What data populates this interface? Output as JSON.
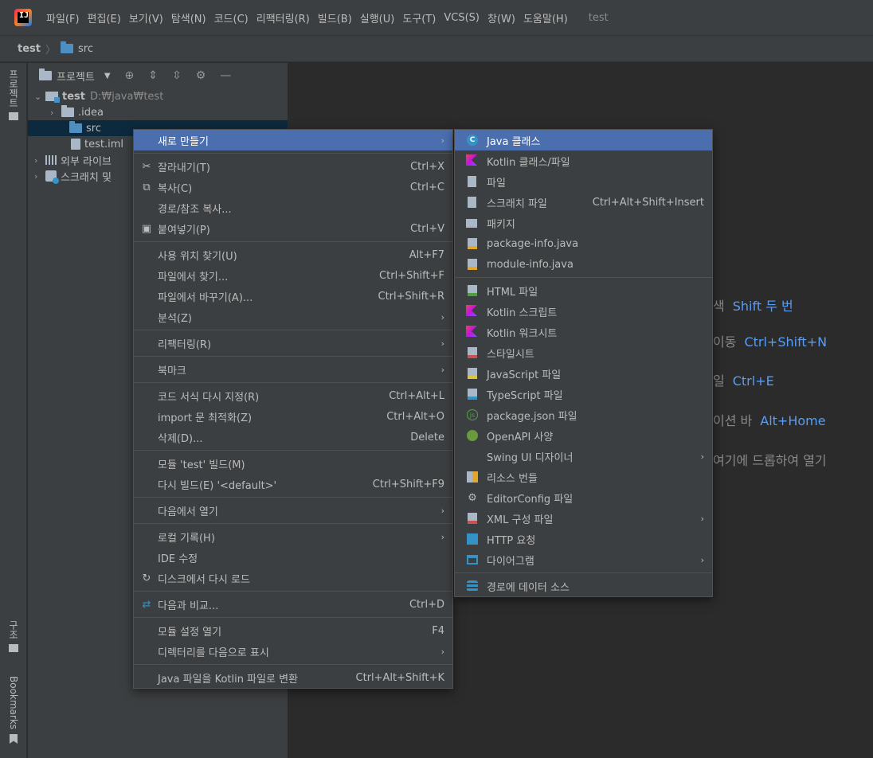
{
  "window": {
    "title": "test"
  },
  "menubar": {
    "items": [
      "파일(F)",
      "편집(E)",
      "보기(V)",
      "탐색(N)",
      "코드(C)",
      "리팩터링(R)",
      "빌드(B)",
      "실행(U)",
      "도구(T)",
      "VCS(S)",
      "창(W)",
      "도움말(H)"
    ]
  },
  "breadcrumb": {
    "project": "test",
    "separator": "〉",
    "folder": "src"
  },
  "left_strip": {
    "project_label": "프로젝트",
    "structure_label": "구조",
    "bookmarks_label": "Bookmarks"
  },
  "project_panel": {
    "title": "프로젝트",
    "tree": [
      {
        "label": "test",
        "path": "D:₩java₩test"
      },
      {
        "label": ".idea"
      },
      {
        "label": "src"
      },
      {
        "label": "test.iml"
      },
      {
        "label": "외부 라이브"
      },
      {
        "label": "스크래치 및"
      }
    ]
  },
  "editor_hints": [
    {
      "text": "색",
      "key": "Shift 두 번"
    },
    {
      "text": "이동",
      "key": "Ctrl+Shift+N"
    },
    {
      "text": "일",
      "key": "Ctrl+E"
    },
    {
      "text": "이션 바",
      "key": "Alt+Home"
    },
    {
      "text": "여기에 드롭하여 열기",
      "key": ""
    }
  ],
  "context_menu": {
    "items": [
      {
        "label": "새로 만들기",
        "shortcut": "",
        "submenu": true,
        "icon": ""
      },
      {
        "label": "잘라내기(T)",
        "shortcut": "Ctrl+X",
        "icon": "scissors-icon"
      },
      {
        "label": "복사(C)",
        "shortcut": "Ctrl+C",
        "icon": "copy-icon"
      },
      {
        "label": "경로/참조 복사...",
        "shortcut": ""
      },
      {
        "label": "붙여넣기(P)",
        "shortcut": "Ctrl+V",
        "icon": "paste-icon"
      },
      {
        "label": "사용 위치 찾기(U)",
        "shortcut": "Alt+F7"
      },
      {
        "label": "파일에서 찾기...",
        "shortcut": "Ctrl+Shift+F"
      },
      {
        "label": "파일에서 바꾸기(A)...",
        "shortcut": "Ctrl+Shift+R"
      },
      {
        "label": "분석(Z)",
        "shortcut": "",
        "submenu": true
      },
      {
        "label": "리팩터링(R)",
        "shortcut": "",
        "submenu": true
      },
      {
        "label": "북마크",
        "shortcut": "",
        "submenu": true
      },
      {
        "label": "코드 서식 다시 지정(R)",
        "shortcut": "Ctrl+Alt+L"
      },
      {
        "label": "import 문 최적화(Z)",
        "shortcut": "Ctrl+Alt+O"
      },
      {
        "label": "삭제(D)...",
        "shortcut": "Delete"
      },
      {
        "label": "모듈 'test' 빌드(M)",
        "shortcut": ""
      },
      {
        "label": "다시 빌드(E) '<default>'",
        "shortcut": "Ctrl+Shift+F9"
      },
      {
        "label": "다음에서 열기",
        "shortcut": "",
        "submenu": true
      },
      {
        "label": "로컬 기록(H)",
        "shortcut": "",
        "submenu": true
      },
      {
        "label": "IDE 수정",
        "shortcut": ""
      },
      {
        "label": "디스크에서 다시 로드",
        "shortcut": "",
        "icon": "refresh-icon"
      },
      {
        "label": "다음과 비교...",
        "shortcut": "Ctrl+D",
        "icon": "compare-icon"
      },
      {
        "label": "모듈 설정 열기",
        "shortcut": "F4"
      },
      {
        "label": "디렉터리를 다음으로 표시",
        "shortcut": "",
        "submenu": true
      },
      {
        "label": "Java 파일을 Kotlin 파일로 변환",
        "shortcut": "Ctrl+Alt+Shift+K"
      }
    ]
  },
  "submenu": {
    "items": [
      {
        "label": "Java 클래스",
        "shortcut": "",
        "icon": "java-class-icon"
      },
      {
        "label": "Kotlin 클래스/파일",
        "shortcut": "",
        "icon": "kotlin-icon"
      },
      {
        "label": "파일",
        "shortcut": "",
        "icon": "file-icon"
      },
      {
        "label": "스크래치 파일",
        "shortcut": "Ctrl+Alt+Shift+Insert",
        "icon": "scratch-file-icon"
      },
      {
        "label": "패키지",
        "shortcut": "",
        "icon": "package-icon"
      },
      {
        "label": "package-info.java",
        "shortcut": "",
        "icon": "java-file-icon"
      },
      {
        "label": "module-info.java",
        "shortcut": "",
        "icon": "java-file-icon"
      },
      {
        "label": "HTML 파일",
        "shortcut": "",
        "icon": "html-icon"
      },
      {
        "label": "Kotlin 스크립트",
        "shortcut": "",
        "icon": "kotlin-icon"
      },
      {
        "label": "Kotlin 워크시트",
        "shortcut": "",
        "icon": "kotlin-icon"
      },
      {
        "label": "스타일시트",
        "shortcut": "",
        "icon": "css-icon"
      },
      {
        "label": "JavaScript 파일",
        "shortcut": "",
        "icon": "js-icon"
      },
      {
        "label": "TypeScript 파일",
        "shortcut": "",
        "icon": "ts-icon"
      },
      {
        "label": "package.json 파일",
        "shortcut": "",
        "icon": "json-icon"
      },
      {
        "label": "OpenAPI 사양",
        "shortcut": "",
        "icon": "openapi-icon"
      },
      {
        "label": "Swing UI 디자이너",
        "shortcut": "",
        "submenu": true
      },
      {
        "label": "리소스 번들",
        "shortcut": "",
        "icon": "bundle-icon"
      },
      {
        "label": "EditorConfig 파일",
        "shortcut": "",
        "icon": "gear-icon"
      },
      {
        "label": "XML 구성 파일",
        "shortcut": "",
        "submenu": true,
        "icon": "xml-icon"
      },
      {
        "label": "HTTP 요청",
        "shortcut": "",
        "icon": "http-icon"
      },
      {
        "label": "다이어그램",
        "shortcut": "",
        "submenu": true,
        "icon": "diagram-icon"
      },
      {
        "label": "경로에 데이터 소스",
        "shortcut": "",
        "icon": "database-icon"
      }
    ]
  },
  "colors": {
    "menu_bg": "#3c3f41",
    "selection": "#4b6eaf",
    "editor_bg": "#2b2b2b",
    "hint_key": "#589df6"
  }
}
